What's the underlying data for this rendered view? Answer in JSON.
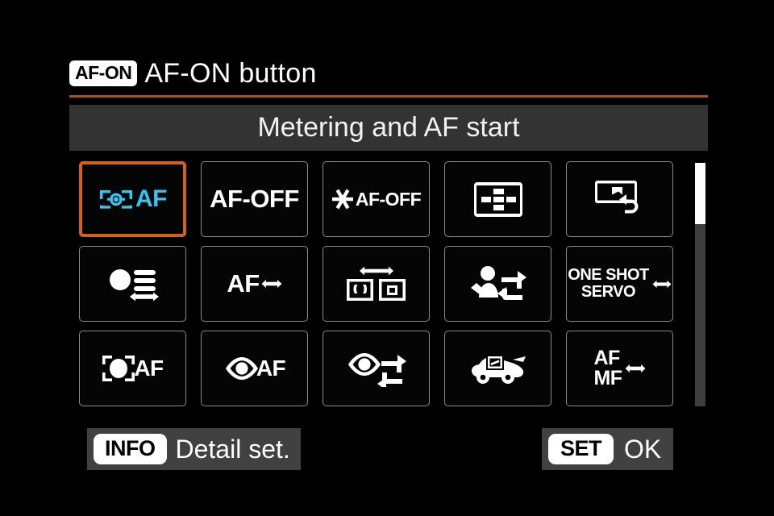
{
  "header": {
    "button_badge": "AF-ON",
    "title": "AF-ON button"
  },
  "subtitle": {
    "text": "Metering and AF start"
  },
  "colors": {
    "selection_border": "#d4631a",
    "selected_icon": "#34c6ef",
    "title_rule": "#a9521c",
    "band_background": "#333333",
    "panel_background": "#414141",
    "tile_border": "#8a8a8a",
    "scrollbar_thumb": "#ffffff",
    "scrollbar_track": "#3e3e3e"
  },
  "grid": {
    "columns": 5,
    "rows": 3,
    "selected_index": 0,
    "tiles": [
      {
        "name": "metering-and-af-start",
        "icon": "camera-frame-af-icon",
        "label": "AF",
        "selected": true
      },
      {
        "name": "af-off",
        "icon": "text-icon",
        "label": "AF-OFF",
        "selected": false
      },
      {
        "name": "ae-lock-af-off",
        "icon": "asterisk-af-off-icon",
        "label": "AF-OFF",
        "selected": false
      },
      {
        "name": "af-point-selection",
        "icon": "af-point-grid-icon",
        "label": "",
        "selected": false
      },
      {
        "name": "register-recall-shooting-function",
        "icon": "register-recall-icon",
        "label": "",
        "selected": false
      },
      {
        "name": "metering-mode-switch",
        "icon": "metering-mode-switch-icon",
        "label": "",
        "selected": false
      },
      {
        "name": "af-mode-switch",
        "icon": "af-switch-icon",
        "label": "AF",
        "selected": false
      },
      {
        "name": "af-area-switch",
        "icon": "af-area-switch-icon",
        "label": "",
        "selected": false
      },
      {
        "name": "subject-to-detect-switch",
        "icon": "person-cycle-icon",
        "label": "",
        "selected": false
      },
      {
        "name": "one-shot-servo-switch",
        "icon": "text-icon",
        "label": "ONE SHOT\nSERVO",
        "label_line1": "ONE SHOT",
        "label_line2": "SERVO",
        "selected": false
      },
      {
        "name": "whole-area-af",
        "icon": "bracket-subject-af-icon",
        "label": "AF",
        "selected": false
      },
      {
        "name": "eye-detection-af",
        "icon": "eye-af-icon",
        "label": "AF",
        "selected": false
      },
      {
        "name": "eye-detection-switch",
        "icon": "eye-cycle-icon",
        "label": "",
        "selected": false
      },
      {
        "name": "vehicle-spot-detection",
        "icon": "vehicle-spot-icon",
        "label": "",
        "selected": false
      },
      {
        "name": "af-mf-switch",
        "icon": "text-icon",
        "label": "AF\nMF",
        "label_line1": "AF",
        "label_line2": "MF",
        "selected": false
      }
    ]
  },
  "scrollbar": {
    "thumb_position_percent": 0,
    "thumb_size_percent": 25
  },
  "footer": {
    "info_badge": "INFO",
    "info_label": "Detail set.",
    "set_badge": "SET",
    "set_label": "OK"
  }
}
